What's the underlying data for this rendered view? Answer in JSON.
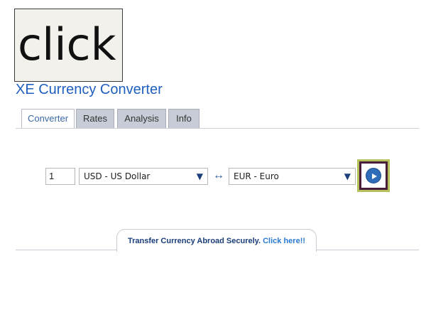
{
  "overlay": {
    "text": "click"
  },
  "app": {
    "title": "XE Currency Converter"
  },
  "tabs": [
    {
      "label": "Converter",
      "active": true
    },
    {
      "label": "Rates",
      "active": false
    },
    {
      "label": "Analysis",
      "active": false
    },
    {
      "label": "Info",
      "active": false
    }
  ],
  "converter": {
    "amount": "1",
    "from_currency": "USD - US Dollar",
    "to_currency": "EUR - Euro",
    "swap_symbol": "↔"
  },
  "banner": {
    "text": "Transfer Currency Abroad Securely.",
    "link_text": "Click here!!"
  },
  "colors": {
    "accent": "#1f5fbf",
    "highlight_border": "#b5c15a",
    "highlight_fill": "#4a1d3a"
  }
}
